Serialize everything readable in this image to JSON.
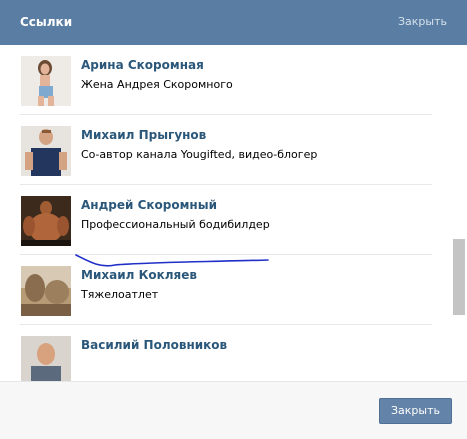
{
  "header": {
    "title": "Ссылки",
    "close_label": "Закрыть"
  },
  "items": [
    {
      "name": "",
      "desc": "",
      "avatar": "partial-photo"
    },
    {
      "name": "Арина Скоромная",
      "desc": "Жена Андрея Скоромного",
      "avatar": "woman-photo"
    },
    {
      "name": "Михаил Прыгунов",
      "desc": "Со-автор канала Yougifted, видео-блогер",
      "avatar": "man-photo"
    },
    {
      "name": "Андрей Скоромный",
      "desc": "Профессиональный бодибилдер",
      "avatar": "bodybuilder-photo"
    },
    {
      "name": "Михаил Кокляев",
      "desc": "Тяжелоатлет",
      "avatar": "landscape-photo"
    },
    {
      "name": "Василий Половников",
      "desc": "",
      "avatar": "man-photo"
    }
  ],
  "footer": {
    "close_button_label": "Закрыть"
  },
  "colors": {
    "header_bg": "#597da3",
    "link": "#2b587a",
    "button_bg": "#6383a8",
    "annotation_stroke": "#1f2fc8"
  }
}
